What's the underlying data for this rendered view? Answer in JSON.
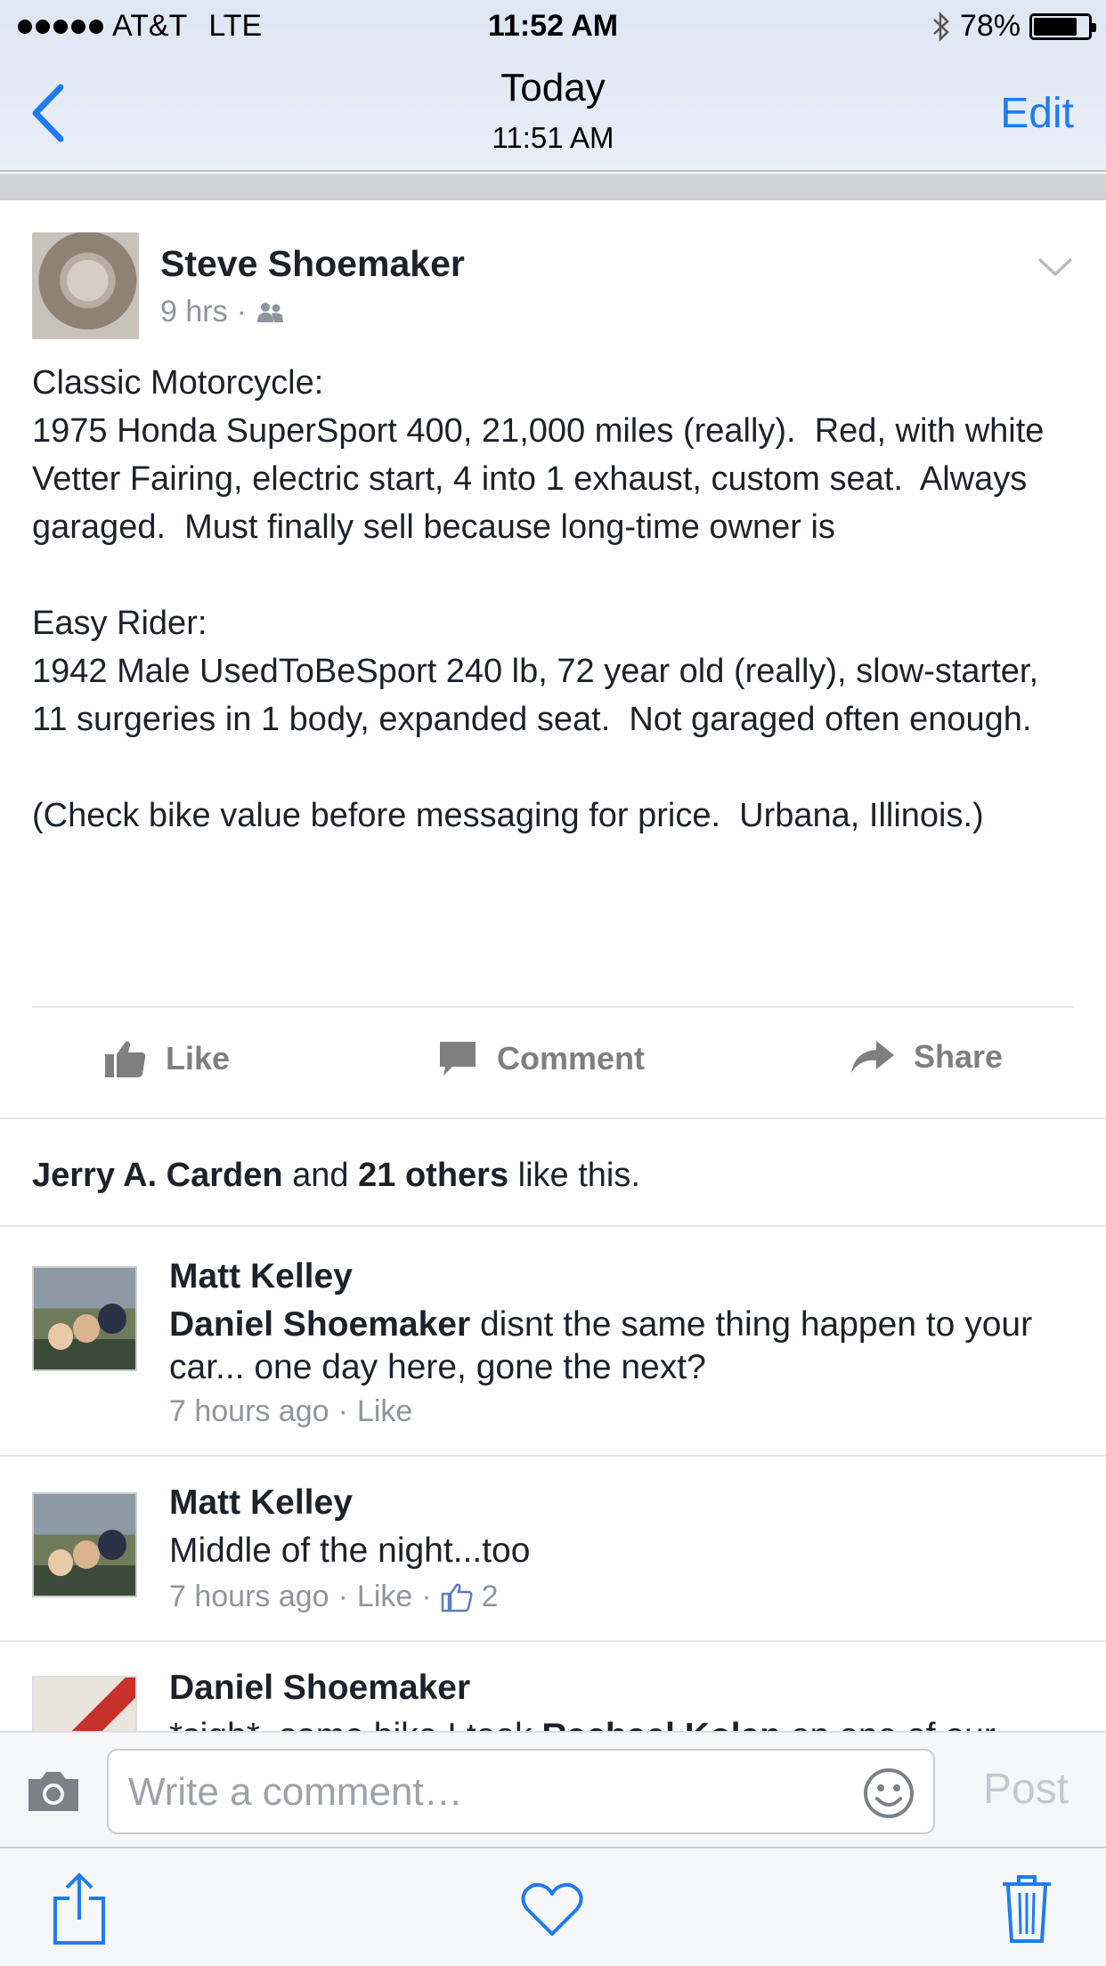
{
  "status": {
    "carrier": "AT&T",
    "network": "LTE",
    "time": "11:52 AM",
    "battery": "78%",
    "battery_level": 0.78
  },
  "nav": {
    "title": "Today",
    "subtitle": "11:51 AM",
    "edit_label": "Edit"
  },
  "post": {
    "author": "Steve Shoemaker",
    "time": "9 hrs",
    "separator": "·",
    "body": "Classic Motorcycle:\n1975 Honda SuperSport 400, 21,000 miles (really).  Red, with white Vetter Fairing, electric start, 4 into 1 exhaust, custom seat.  Always garaged.  Must finally sell because long-time owner is\n\nEasy Rider:\n1942 Male UsedToBeSport 240 lb, 72 year old (really), slow-starter, 11 surgeries in 1 body, expanded seat.  Not garaged often enough.\n\n(Check bike value before messaging for price.  Urbana, Illinois.)",
    "actions": {
      "like": "Like",
      "comment": "Comment",
      "share": "Share"
    },
    "likes": {
      "name": "Jerry A. Carden",
      "and": " and ",
      "others": "21 others",
      "suffix": " like this."
    }
  },
  "comments": [
    {
      "author": "Matt Kelley",
      "mention": "Daniel Shoemaker",
      "text": " disnt the same thing happen to your car... one day here, gone the next?",
      "time": "7 hours ago",
      "sep": "·",
      "like": "Like"
    },
    {
      "author": "Matt Kelley",
      "text": "Middle of the night...too",
      "time": "7 hours ago",
      "sep": "·",
      "like": "Like",
      "sep2": "·",
      "like_count": "2"
    },
    {
      "author": "Daniel Shoemaker",
      "text_start": "*sigh*, same bike I took ",
      "mention": "Rachael Kolan",
      "text_end": " on one of our"
    }
  ],
  "composer": {
    "placeholder": "Write a comment…",
    "post_label": "Post"
  },
  "colors": {
    "accent": "#1f7cf0",
    "text": "#1d2129",
    "meta": "#90949c"
  }
}
